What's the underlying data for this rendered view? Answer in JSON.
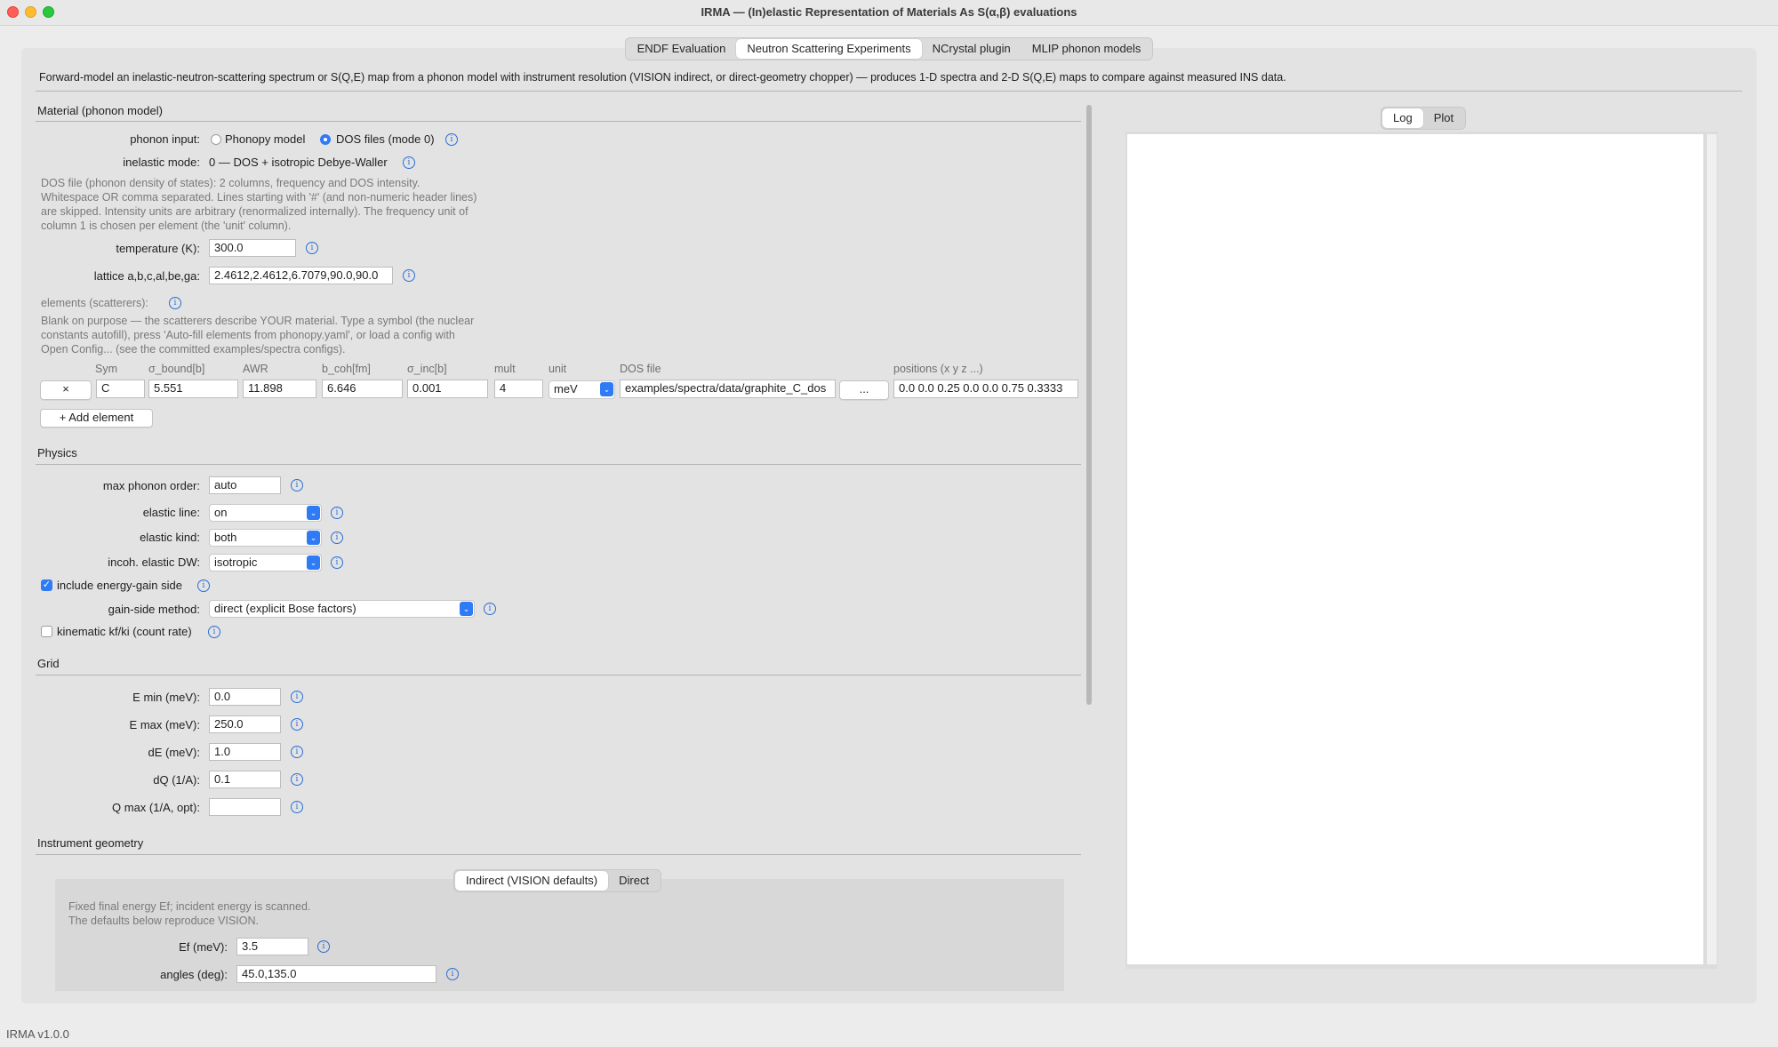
{
  "window": {
    "title": "IRMA — (In)elastic Representation of Materials As S(α,β) evaluations"
  },
  "tabs": [
    {
      "label": "ENDF Evaluation",
      "active": false
    },
    {
      "label": "Neutron Scattering Experiments",
      "active": true
    },
    {
      "label": "NCrystal plugin",
      "active": false
    },
    {
      "label": "MLIP phonon models",
      "active": false
    }
  ],
  "description": "Forward-model an inelastic-neutron-scattering spectrum or S(Q,E) map from a phonon model with instrument resolution (VISION indirect, or direct-geometry chopper) — produces 1-D spectra and 2-D S(Q,E) maps to compare against measured INS data.",
  "material": {
    "section_title": "Material (phonon model)",
    "phonon_input_label": "phonon input:",
    "phonon_input_options": [
      "Phonopy model",
      "DOS files (mode 0)"
    ],
    "phonon_input_selected": "DOS files (mode 0)",
    "inelastic_mode_label": "inelastic mode:",
    "inelastic_mode_value": "0 — DOS + isotropic Debye-Waller",
    "dos_help": [
      "DOS file (phonon density of states): 2 columns, frequency and DOS intensity.",
      "Whitespace OR comma separated. Lines starting with '#' (and non-numeric header lines)",
      "are skipped. Intensity units are arbitrary (renormalized internally). The frequency unit of",
      "column 1 is chosen per element (the 'unit' column)."
    ],
    "temperature_label": "temperature (K):",
    "temperature_value": "300.0",
    "lattice_label": "lattice a,b,c,al,be,ga:",
    "lattice_value": "2.4612,2.4612,6.7079,90.0,90.0",
    "elements_label": "elements (scatterers):",
    "elements_help": [
      "Blank on purpose — the scatterers describe YOUR material. Type a symbol (the nuclear",
      "constants autofill), press 'Auto-fill elements from phonopy.yaml', or load a config with",
      "Open Config... (see the committed examples/spectra configs)."
    ],
    "columns": [
      "Sym",
      "σ_bound[b]",
      "AWR",
      "b_coh[fm]",
      "σ_inc[b]",
      "mult",
      "unit",
      "DOS file",
      "positions (x y z ...)"
    ],
    "rows": [
      {
        "remove_label": "×",
        "sym": "C",
        "sigma_bound": "5.551",
        "awr": "11.898",
        "b_coh": "6.646",
        "sigma_inc": "0.001",
        "mult": "4",
        "unit": "meV",
        "dos_file": "examples/spectra/data/graphite_C_dos",
        "browse_label": "...",
        "positions": "0.0 0.0 0.25 0.0 0.0 0.75 0.3333"
      }
    ],
    "add_element_label": "+ Add element"
  },
  "physics": {
    "section_title": "Physics",
    "max_phonon_order_label": "max phonon order:",
    "max_phonon_order_value": "auto",
    "elastic_line_label": "elastic line:",
    "elastic_line_value": "on",
    "elastic_kind_label": "elastic kind:",
    "elastic_kind_value": "both",
    "incoh_elastic_dw_label": "incoh. elastic DW:",
    "incoh_elastic_dw_value": "isotropic",
    "energy_gain_label": "include energy-gain side",
    "energy_gain_checked": true,
    "gain_side_method_label": "gain-side method:",
    "gain_side_method_value": "direct (explicit Bose factors)",
    "kinematic_label": "kinematic kf/ki (count rate)",
    "kinematic_checked": false
  },
  "grid": {
    "section_title": "Grid",
    "emin_label": "E min (meV):",
    "emin_value": "0.0",
    "emax_label": "E max (meV):",
    "emax_value": "250.0",
    "de_label": "dE (meV):",
    "de_value": "1.0",
    "dq_label": "dQ (1/A):",
    "dq_value": "0.1",
    "qmax_label": "Q max (1/A, opt):",
    "qmax_value": ""
  },
  "instrument": {
    "section_title": "Instrument geometry",
    "subtabs": [
      {
        "label": "Indirect (VISION defaults)",
        "active": true
      },
      {
        "label": "Direct",
        "active": false
      }
    ],
    "help": [
      "Fixed final energy Ef; incident energy is scanned.",
      "The defaults below reproduce VISION."
    ],
    "ef_label": "Ef (meV):",
    "ef_value": "3.5",
    "angles_label": "angles (deg):",
    "angles_value": "45.0,135.0"
  },
  "output": {
    "tabs": [
      {
        "label": "Log",
        "active": true
      },
      {
        "label": "Plot",
        "active": false
      }
    ],
    "log_text": ""
  },
  "status": "IRMA v1.0.0",
  "colors": {
    "accent": "#2f7bf5",
    "info_icon": "#2a6fd6",
    "traffic_close": "#ff5f57",
    "traffic_min": "#febc2e",
    "traffic_max": "#28c840"
  }
}
